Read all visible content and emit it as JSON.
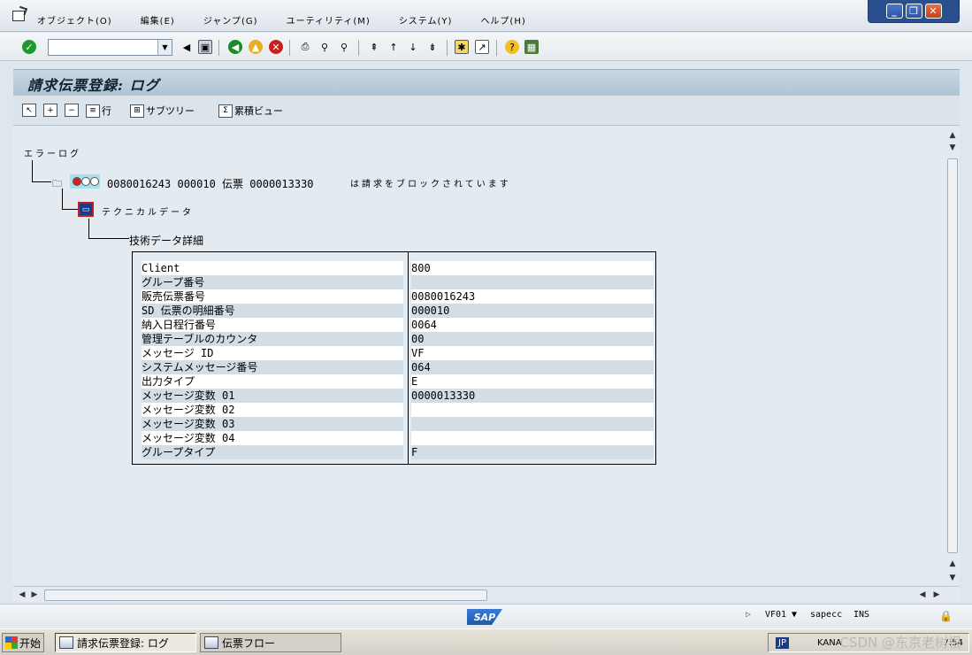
{
  "menu": {
    "items": [
      "オブジェクト(O)",
      "編集(E)",
      "ジャンプ(G)",
      "ユーティリティ(M)",
      "システム(Y)",
      "ヘルプ(H)"
    ]
  },
  "window_buttons": {
    "minimize": "_",
    "restore": "❐",
    "close": "✕"
  },
  "toolbar": {
    "command_field_value": "",
    "icons": [
      "enter-icon",
      "save-icon",
      "back-icon",
      "exit-icon",
      "cancel-icon",
      "print-icon",
      "find-icon",
      "find-next-icon",
      "first-page-icon",
      "previous-page-icon",
      "next-page-icon",
      "last-page-icon",
      "create-session-icon",
      "shortcut-icon",
      "help-icon",
      "layout-icon"
    ]
  },
  "title": "請求伝票登録: ログ",
  "app_toolbar": {
    "row_label": "行",
    "subtree_label": "サブツリー",
    "cumulative_label": "累積ビュー"
  },
  "tree": {
    "root_label": "エラーログ",
    "message_text_main": "0080016243 000010 伝票 0000013330",
    "message_text_suffix": "は請求をブロックされています",
    "technical_label": "テクニカルデータ",
    "detail_label": "技術データ詳細"
  },
  "details": [
    {
      "label": "Client",
      "value": "800"
    },
    {
      "label": "グループ番号",
      "value": ""
    },
    {
      "label": "販売伝票番号",
      "value": "0080016243"
    },
    {
      "label": "SD 伝票の明細番号",
      "value": "000010"
    },
    {
      "label": "納入日程行番号",
      "value": "0064"
    },
    {
      "label": "管理テーブルのカウンタ",
      "value": "00"
    },
    {
      "label": "メッセージ ID",
      "value": "VF"
    },
    {
      "label": "システムメッセージ番号",
      "value": "064"
    },
    {
      "label": "出力タイプ",
      "value": "E"
    },
    {
      "label": "メッセージ変数 01",
      "value": "0000013330"
    },
    {
      "label": "メッセージ変数 02",
      "value": ""
    },
    {
      "label": "メッセージ変数 03",
      "value": ""
    },
    {
      "label": "メッセージ変数 04",
      "value": ""
    },
    {
      "label": "グループタイプ",
      "value": "F"
    }
  ],
  "statusbar": {
    "logo": "SAP",
    "transaction": "VF01",
    "server": "sapecc",
    "mode": "INS"
  },
  "taskbar": {
    "start_label": "开始",
    "task1": "請求伝票登録: ログ",
    "task2": "伝票フロー",
    "lang": "JP",
    "ime": "KANA",
    "clock": "7:54",
    "watermark": "CSDN @东京老树根"
  },
  "colors": {
    "title_band": "#c8d8e4",
    "content_bg": "#e3ebf1",
    "row_shaded": "#d2dde6",
    "status_error": "#d62020",
    "winbtn_blue": "#2a4f8e"
  }
}
